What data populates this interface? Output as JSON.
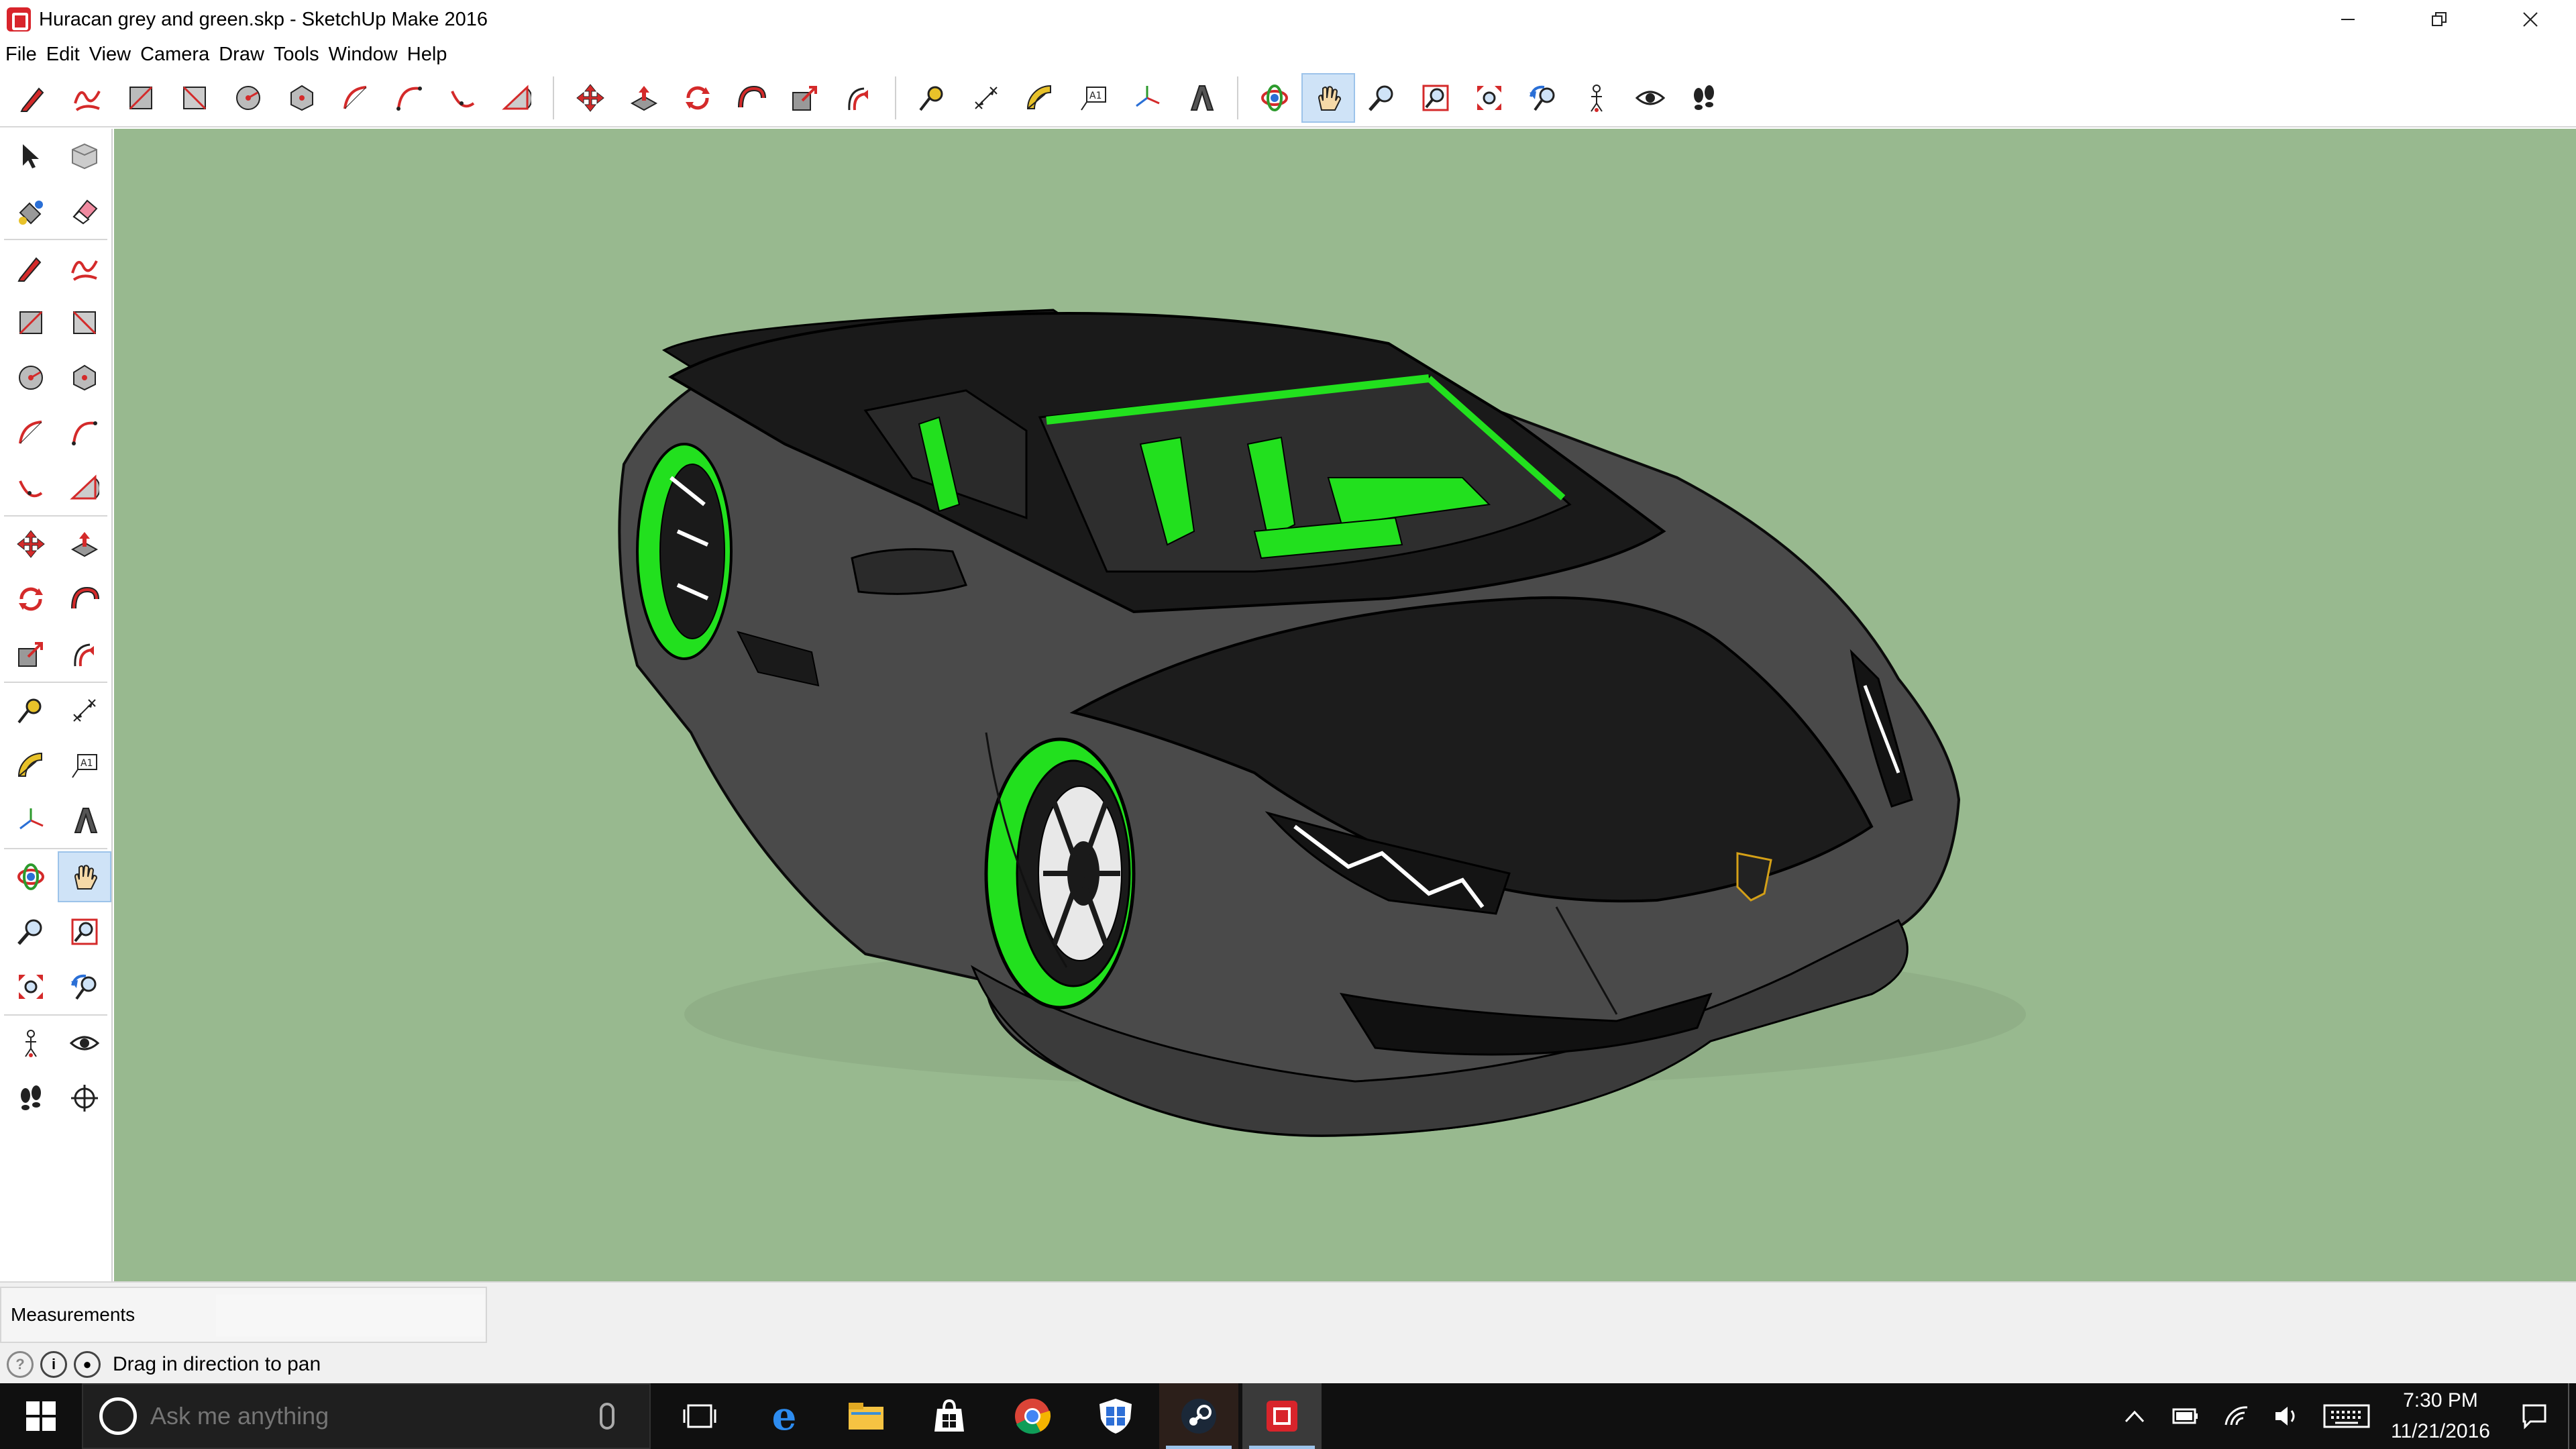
{
  "window": {
    "title": "Huracan grey and green.skp - SketchUp Make 2016",
    "controls": [
      "minimize",
      "restore",
      "close"
    ]
  },
  "menu": [
    "File",
    "Edit",
    "View",
    "Camera",
    "Draw",
    "Tools",
    "Window",
    "Help"
  ],
  "toolbar": {
    "tools": [
      "pencil-icon",
      "freehand-icon",
      "rectangle-icon",
      "rotated-rectangle-icon",
      "circle-icon",
      "polygon-icon",
      "arc-icon",
      "two-point-arc-icon",
      "three-point-arc-icon",
      "pie-icon",
      "move-icon",
      "push-pull-icon",
      "rotate-icon",
      "follow-me-icon",
      "scale-icon",
      "offset-icon",
      "tape-measure-icon",
      "dimension-icon",
      "protractor-icon",
      "text-icon",
      "axes-icon",
      "3d-text-icon",
      "orbit-icon",
      "pan-icon",
      "zoom-icon",
      "zoom-window-icon",
      "zoom-extents-icon",
      "previous-view-icon",
      "position-camera-icon",
      "look-around-icon",
      "walk-icon"
    ],
    "active_tool": "pan-icon"
  },
  "palette": {
    "rows": [
      [
        "select-icon",
        "make-component-icon"
      ],
      [
        "paint-bucket-icon",
        "eraser-icon"
      ],
      [
        "pencil-icon",
        "freehand-icon"
      ],
      [
        "rectangle-icon",
        "rotated-rectangle-icon"
      ],
      [
        "circle-icon",
        "polygon-icon"
      ],
      [
        "arc-icon",
        "two-point-arc-icon"
      ],
      [
        "three-point-arc-icon",
        "pie-icon"
      ],
      [
        "move-icon",
        "push-pull-icon"
      ],
      [
        "rotate-icon",
        "follow-me-icon"
      ],
      [
        "scale-icon",
        "offset-icon"
      ],
      [
        "tape-measure-icon",
        "dimension-icon"
      ],
      [
        "protractor-icon",
        "text-icon"
      ],
      [
        "axes-icon",
        "3d-text-icon"
      ],
      [
        "orbit-icon",
        "pan-icon"
      ],
      [
        "zoom-icon",
        "zoom-window-icon"
      ],
      [
        "zoom-extents-icon",
        "previous-view-icon"
      ],
      [
        "position-camera-icon",
        "look-around-icon"
      ],
      [
        "walk-icon",
        "section-plane-icon"
      ]
    ]
  },
  "viewport": {
    "background": "#98b98f",
    "body_color": "#4a4a4a",
    "roof_color": "#1e1e1e",
    "accent_color": "#22e01e"
  },
  "measurements": {
    "label": "Measurements",
    "value": ""
  },
  "status": {
    "message": "Drag in direction to pan"
  },
  "taskbar": {
    "search_placeholder": "Ask me anything",
    "apps": [
      "task-view-icon",
      "edge-icon",
      "file-explorer-icon",
      "store-icon",
      "chrome-icon",
      "defender-icon",
      "steam-icon",
      "sketchup-icon"
    ],
    "time": "7:30 PM",
    "date": "11/21/2016"
  }
}
